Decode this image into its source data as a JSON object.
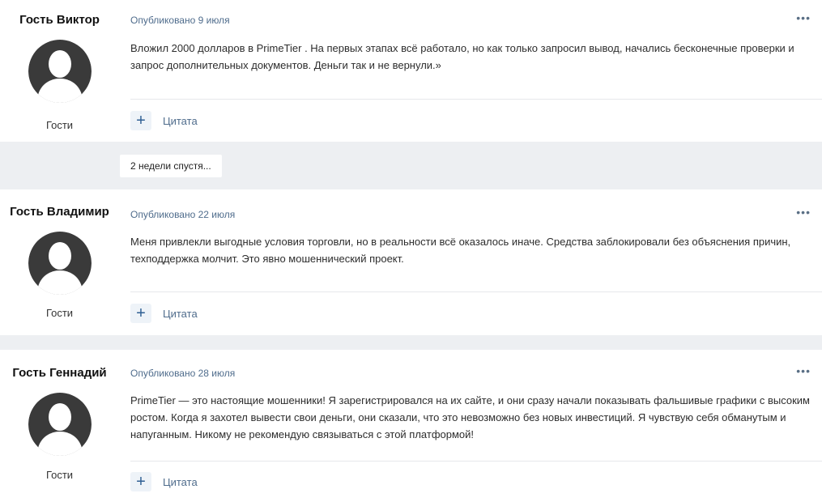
{
  "posts": [
    {
      "author": "Гость Виктор",
      "group": "Гости",
      "date": "Опубликовано 9 июля",
      "text": "Вложил 2000 долларов в PrimeTier . На первых этапах всё работало, но как только запросил вывод, начались бесконечные проверки и запрос дополнительных документов. Деньги так и не вернули.»",
      "quote_label": "Цитата",
      "plus_label": "+",
      "more_label": "•••"
    },
    {
      "author": "Гость Владимир",
      "group": "Гости",
      "date": "Опубликовано 22 июля",
      "text": "Меня привлекли выгодные условия торговли, но в реальности всё оказалось иначе. Средства заблокировали без объяснения причин, техподдержка молчит. Это явно мошеннический проект.",
      "quote_label": "Цитата",
      "plus_label": "+",
      "more_label": "•••"
    },
    {
      "author": "Гость Геннадий",
      "group": "Гости",
      "date": "Опубликовано 28 июля",
      "text": "PrimeTier — это настоящие мошенники! Я зарегистрировался на их сайте, и они сразу начали показывать фальшивые графики с высоким ростом. Когда я захотел вывести свои деньги, они сказали, что это невозможно без новых инвестиций. Я чувствую себя обманутым и напуганным. Никому не рекомендую связываться с этой платформой!",
      "quote_label": "Цитата",
      "plus_label": "+",
      "more_label": "•••"
    }
  ],
  "time_gap_label": "2 недели спустя...",
  "colors": {
    "meta": "#4f6c8c",
    "gap_bg": "#edeff2",
    "plus_bg": "#eef3f8",
    "plus_fg": "#2f5f93",
    "avatar_silhouette": "#3a3a3a"
  },
  "icons": {
    "avatar": "default-user-silhouette-icon",
    "more": "ellipsis-icon",
    "plus": "plus-icon"
  }
}
